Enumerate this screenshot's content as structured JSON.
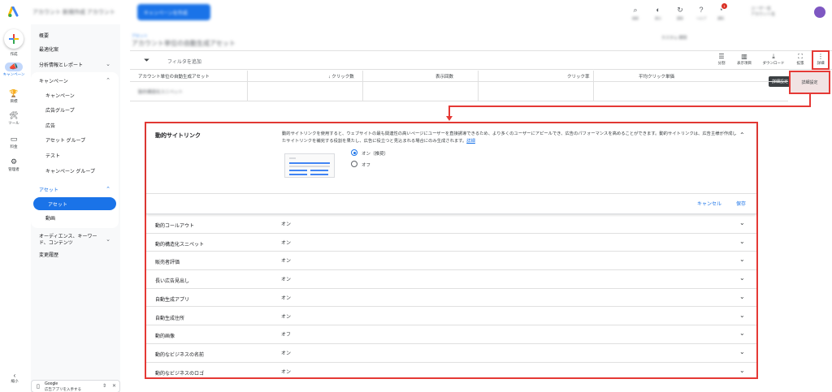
{
  "topbar": {
    "account": "アカウント 新規作成",
    "account_sub": "アカウント",
    "create_button": "キャンペーンを作成",
    "icons": [
      {
        "name": "search-icon",
        "glyph": "⌕",
        "label": "検索"
      },
      {
        "name": "appearance-icon",
        "glyph": "◐",
        "label": "表示"
      },
      {
        "name": "refresh-icon",
        "glyph": "↻",
        "label": "更新"
      },
      {
        "name": "help-icon",
        "glyph": "?",
        "label": "ヘルプ"
      },
      {
        "name": "notifications-icon",
        "glyph": "🔔",
        "label": "通知"
      }
    ],
    "notification_count": "1",
    "user_line1": "ユーザー名",
    "user_line2": "アカウント名"
  },
  "rail": {
    "create_label": "作成",
    "items": [
      {
        "name": "campaigns",
        "glyph": "📣",
        "label": "キャンペーン"
      },
      {
        "name": "goals",
        "glyph": "🏆",
        "label": "目標"
      },
      {
        "name": "tools",
        "glyph": "🛠",
        "label": "ツール"
      },
      {
        "name": "billing",
        "glyph": "▭",
        "label": "料金"
      },
      {
        "name": "admin",
        "glyph": "⚙",
        "label": "管理者"
      }
    ],
    "collapse_label": "縮小"
  },
  "nav": {
    "overview": "概要",
    "recommendations": "最適化案",
    "insights": "分析情報とレポート",
    "campaigns_group": "キャンペーン",
    "campaigns_items": [
      "キャンペーン",
      "広告グループ",
      "広告",
      "アセット グループ",
      "テスト",
      "キャンペーン グループ"
    ],
    "assets_group": "アセット",
    "assets_items": [
      "アセット",
      "動画"
    ],
    "audiences": "オーディエンス、キーワード、コンテンツ",
    "change_history": "変更履歴"
  },
  "page": {
    "breadcrumb": "アセット",
    "title": "アカウント単位の自動生成アセット",
    "date_range": "カスタム 期間",
    "filter_label": "フィルタを追加",
    "tools": [
      {
        "name": "segment",
        "glyph": "☰",
        "label": "分割"
      },
      {
        "name": "columns",
        "glyph": "▥",
        "label": "表示項目"
      },
      {
        "name": "download",
        "glyph": "⤓",
        "label": "ダウンロード"
      },
      {
        "name": "expand",
        "glyph": "⛶",
        "label": "拡張"
      },
      {
        "name": "more",
        "glyph": "⋮",
        "label": "詳細"
      }
    ],
    "tooltip": "詳細設定",
    "menu_item": "詳細設定"
  },
  "table": {
    "headers": [
      "アカウント単位の自動生成アセット",
      "↓ クリック数",
      "表示回数",
      "クリック率",
      "平均クリック単価"
    ],
    "row_label": "動的構造化スニペット"
  },
  "panel": {
    "title": "動的サイトリンク",
    "description": "動的サイトリンクを使用すると、ウェブサイトの最も関連性の高いページにユーザーを直接誘導できるため、より多くのユーザーにアピールでき、広告のパフォーマンスを高めることができます。動的サイトリンクは、広告主様が作成したサイトリンクを補完する役割を果たし、広告に役立つと見込まれる場合にのみ生成されます。",
    "link": "詳細",
    "option_on": "オン（推奨）",
    "option_off": "オフ",
    "cancel": "キャンセル",
    "save": "保存"
  },
  "settings": [
    {
      "name": "動的コールアウト",
      "value": "オン"
    },
    {
      "name": "動的構造化スニペット",
      "value": "オン"
    },
    {
      "name": "販売者評価",
      "value": "オン"
    },
    {
      "name": "長い広告見出し",
      "value": "オン"
    },
    {
      "name": "自動生成アプリ",
      "value": "オン"
    },
    {
      "name": "自動生成住所",
      "value": "オン"
    },
    {
      "name": "動的画像",
      "value": "オフ"
    },
    {
      "name": "動的なビジネスの名前",
      "value": "オン"
    },
    {
      "name": "動的なビジネスのロゴ",
      "value": "オン"
    }
  ],
  "google_app": {
    "line1": "Google",
    "line2": "広告アプリを入手する"
  },
  "colors": {
    "accent": "#1a73e8",
    "highlight": "#e53935"
  }
}
